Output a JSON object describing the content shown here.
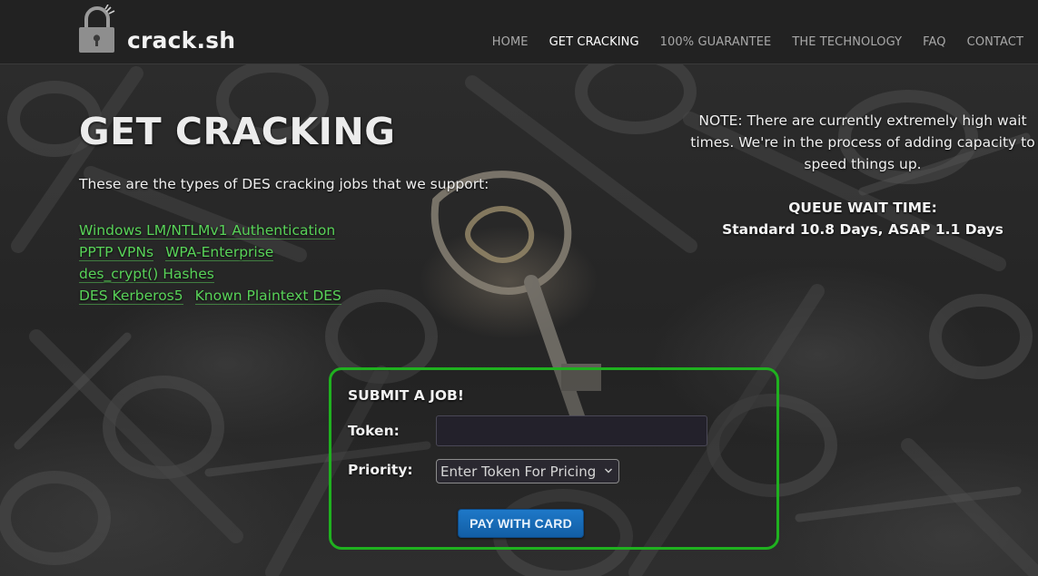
{
  "site": {
    "name": "crack.sh",
    "logo_icon": "padlock-icon"
  },
  "nav": [
    {
      "label": "HOME",
      "active": false
    },
    {
      "label": "GET CRACKING",
      "active": true
    },
    {
      "label": "100% GUARANTEE",
      "active": false
    },
    {
      "label": "THE TECHNOLOGY",
      "active": false
    },
    {
      "label": "FAQ",
      "active": false
    },
    {
      "label": "CONTACT",
      "active": false
    }
  ],
  "main": {
    "title": "GET CRACKING",
    "intro": "These are the types of DES cracking jobs that we support:",
    "job_types": [
      [
        "Windows LM/NTLMv1 Authentication"
      ],
      [
        "PPTP VPNs",
        "WPA-Enterprise"
      ],
      [
        "des_crypt() Hashes"
      ],
      [
        "DES Kerberos5",
        "Known Plaintext DES"
      ]
    ]
  },
  "notice": {
    "text": "NOTE: There are currently extremely high wait times. We're in the process of adding capacity to speed things up.",
    "queue_title": "QUEUE WAIT TIME:",
    "queue_times": "Standard 10.8 Days, ASAP 1.1 Days"
  },
  "form": {
    "title": "SUBMIT A JOB!",
    "token_label": "Token:",
    "token_value": "",
    "priority_label": "Priority:",
    "priority_selected": "Enter Token For Pricing",
    "pay_button": "PAY WITH CARD"
  },
  "colors": {
    "accent_green": "#1fb11f",
    "link_green": "#59d359",
    "button_blue": "#1a6bb8",
    "header_bg": "#222222"
  }
}
